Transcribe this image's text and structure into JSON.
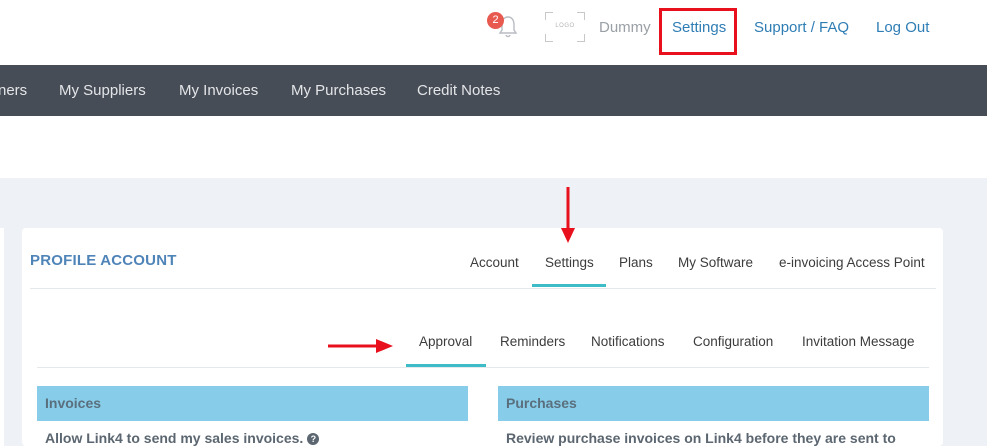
{
  "header": {
    "notification_count": "2",
    "logo_text": "LOGO",
    "user_name": "Dummy",
    "settings_label": "Settings",
    "support_label": "Support / FAQ",
    "logout_label": "Log Out"
  },
  "nav": {
    "items": [
      {
        "label": "ners"
      },
      {
        "label": "My Suppliers"
      },
      {
        "label": "My Invoices"
      },
      {
        "label": "My Purchases"
      },
      {
        "label": "Credit Notes"
      }
    ]
  },
  "profile": {
    "title": "PROFILE ACCOUNT",
    "tabs": [
      {
        "label": "Account"
      },
      {
        "label": "Settings"
      },
      {
        "label": "Plans"
      },
      {
        "label": "My Software"
      },
      {
        "label": "e-invoicing Access Point"
      }
    ],
    "active_tab": "Settings",
    "subtabs": [
      {
        "label": "Approval"
      },
      {
        "label": "Reminders"
      },
      {
        "label": "Notifications"
      },
      {
        "label": "Configuration"
      },
      {
        "label": "Invitation Message"
      }
    ],
    "active_subtab": "Approval"
  },
  "sections": {
    "invoices": {
      "title": "Invoices",
      "text": "Allow Link4 to send my sales invoices."
    },
    "purchases": {
      "title": "Purchases",
      "text": "Review purchase invoices on Link4 before they are sent to"
    }
  },
  "colors": {
    "nav_bg": "#474d56",
    "accent_underline": "#3dbcc7",
    "section_header_bg": "#87cde9",
    "highlight_red": "#e8101c",
    "link_blue": "#2f7db5",
    "title_blue": "#4f84b8"
  },
  "icons": {
    "bell": "bell-icon",
    "help": "question-circle-icon"
  }
}
